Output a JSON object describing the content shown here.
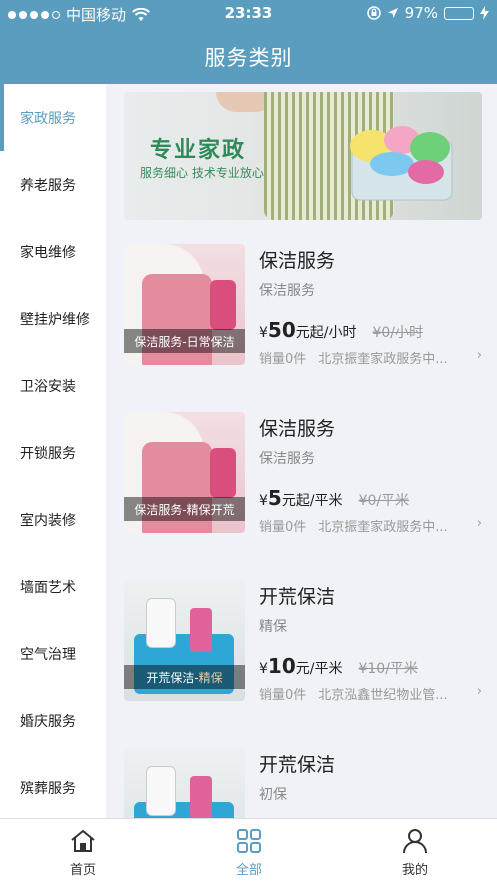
{
  "status_bar": {
    "carrier": "中国移动",
    "time": "23:33",
    "battery": "97%",
    "signal_icon": "signal-dots",
    "wifi_icon": "wifi-icon",
    "lock_icon": "rotation-lock-icon",
    "location_icon": "location-arrow-icon",
    "charge_icon": "charging-bolt-icon"
  },
  "nav": {
    "title": "服务类别"
  },
  "sidebar": {
    "items": [
      {
        "label": "家政服务",
        "active": true
      },
      {
        "label": "养老服务"
      },
      {
        "label": "家电维修"
      },
      {
        "label": "壁挂炉维修"
      },
      {
        "label": "卫浴安装"
      },
      {
        "label": "开锁服务"
      },
      {
        "label": "室内装修"
      },
      {
        "label": "墙面艺术"
      },
      {
        "label": "空气治理"
      },
      {
        "label": "婚庆服务"
      },
      {
        "label": "殡葬服务"
      }
    ]
  },
  "banner": {
    "title": "专业家政",
    "subtitle": "服务细心  技术专业放心"
  },
  "items": [
    {
      "name": "保洁服务",
      "sub": "保洁服务",
      "caption": "保洁服务-日常保洁",
      "price_symbol": "¥",
      "price_num": "50",
      "price_unit": "元起/小时",
      "orig": "¥0/小时",
      "sales": "销量0件",
      "shop": "北京振奎家政服务中...",
      "chevron": "›"
    },
    {
      "name": "保洁服务",
      "sub": "保洁服务",
      "caption": "保洁服务-精保开荒",
      "price_symbol": "¥",
      "price_num": "5",
      "price_unit": "元起/平米",
      "orig": "¥0/平米",
      "sales": "销量0件",
      "shop": "北京振奎家政服务中...",
      "chevron": "›"
    },
    {
      "name": "开荒保洁",
      "sub": "精保",
      "caption_a": "开荒保洁-",
      "caption_b": "精保",
      "price_symbol": "¥",
      "price_num": "10",
      "price_unit": "元/平米",
      "orig": "¥10/平米",
      "sales": "销量0件",
      "shop": "北京泓鑫世纪物业管...",
      "chevron": "›"
    },
    {
      "name": "开荒保洁",
      "sub": "初保"
    }
  ],
  "tabbar": {
    "tabs": [
      {
        "label": "首页",
        "icon": "home-icon"
      },
      {
        "label": "全部",
        "icon": "grid-icon",
        "active": true
      },
      {
        "label": "我的",
        "icon": "person-icon"
      }
    ]
  },
  "colors": {
    "accent": "#5b9dbf",
    "banner_title": "#2f8a5a",
    "battery_fill": "#4cd964"
  }
}
